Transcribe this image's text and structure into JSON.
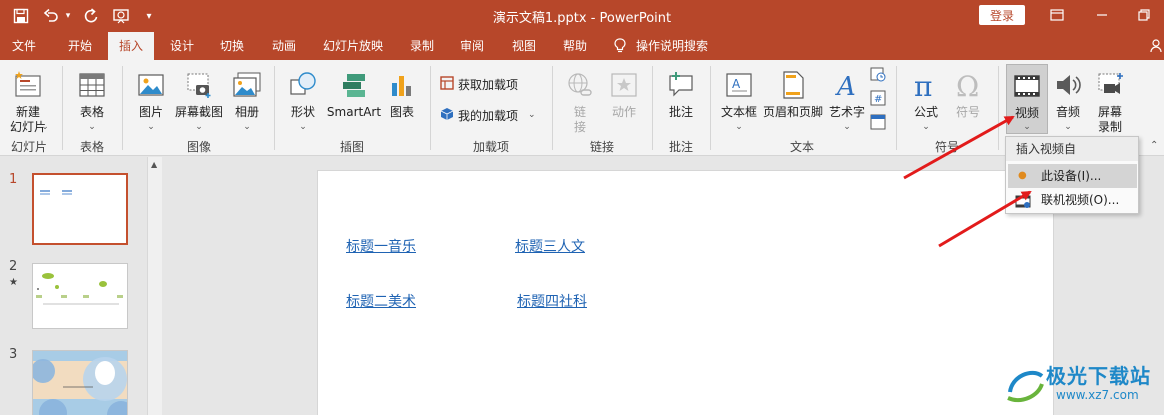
{
  "titlebar": {
    "doc_title": "演示文稿1.pptx - PowerPoint",
    "login_label": "登录",
    "quick_access": [
      "save-icon",
      "undo-icon",
      "redo-icon",
      "slideshow-from-start-icon",
      "customize-icon"
    ]
  },
  "tabs": [
    "文件",
    "开始",
    "插入",
    "设计",
    "切换",
    "动画",
    "幻灯片放映",
    "录制",
    "审阅",
    "视图",
    "帮助"
  ],
  "active_tab": "插入",
  "tell_me": "操作说明搜索",
  "ribbon": {
    "new_slide": {
      "label1": "新建",
      "label2": "幻灯片"
    },
    "table": {
      "label": "表格"
    },
    "picture": {
      "label": "图片"
    },
    "screenshot": {
      "label": "屏幕截图"
    },
    "album": {
      "label": "相册"
    },
    "shapes": {
      "label": "形状"
    },
    "smartart": {
      "label": "SmartArt"
    },
    "chart": {
      "label": "图表"
    },
    "get_addins": {
      "label": "获取加载项"
    },
    "my_addins": {
      "label": "我的加载项"
    },
    "link": {
      "label1": "链",
      "label2": "接"
    },
    "action": {
      "label": "动作"
    },
    "comment": {
      "label": "批注"
    },
    "textbox": {
      "label": "文本框"
    },
    "header_footer": {
      "label": "页眉和页脚"
    },
    "wordart": {
      "label": "艺术字"
    },
    "equation": {
      "label": "公式"
    },
    "symbol": {
      "label": "符号"
    },
    "video": {
      "label": "视频"
    },
    "audio": {
      "label": "音频"
    },
    "screen_record": {
      "label1": "屏幕",
      "label2": "录制"
    },
    "groups": {
      "slides": "幻灯片",
      "tables": "表格",
      "images": "图像",
      "illustrations": "插图",
      "addins": "加载项",
      "links": "链接",
      "comments": "批注",
      "text": "文本",
      "symbols": "符号"
    }
  },
  "video_menu": {
    "header": "插入视频自",
    "items": [
      "此设备(I)...",
      "联机视频(O)..."
    ]
  },
  "thumbnails": [
    "1",
    "2",
    "3"
  ],
  "thumb2_star": "★",
  "slide_links": [
    "标题一音乐",
    "标题三人文",
    "标题二美术",
    "标题四社科"
  ],
  "watermark": {
    "title": "极光下载站",
    "url": "www.xz7.com"
  },
  "colors": {
    "accent": "#b7472a",
    "arrow": "#e21b1b",
    "link": "#1f63b3"
  }
}
